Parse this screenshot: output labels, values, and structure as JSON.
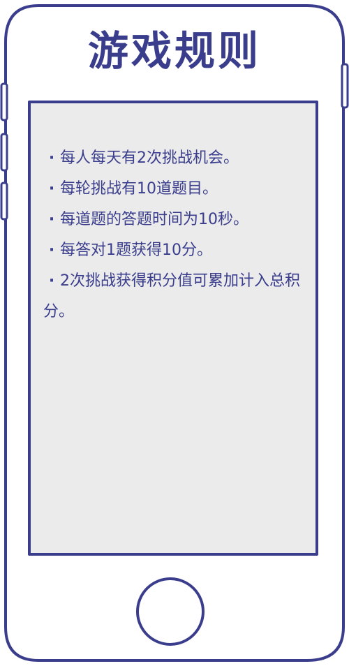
{
  "header": {
    "title": "游戏规则"
  },
  "rules": {
    "bullet": "·",
    "items": [
      "每人每天有2次挑战机会。",
      "每轮挑战有10道题目。",
      "每道题的答题时间为10秒。",
      "每答对1题获得10分。",
      "2次挑战获得积分值可累加计入总积分。"
    ]
  },
  "colors": {
    "accent": "#3a3d8c",
    "screen_background": "#ebebeb",
    "page_background": "#ffffff"
  },
  "icons": {
    "home_button": "circle-home-button-icon"
  }
}
